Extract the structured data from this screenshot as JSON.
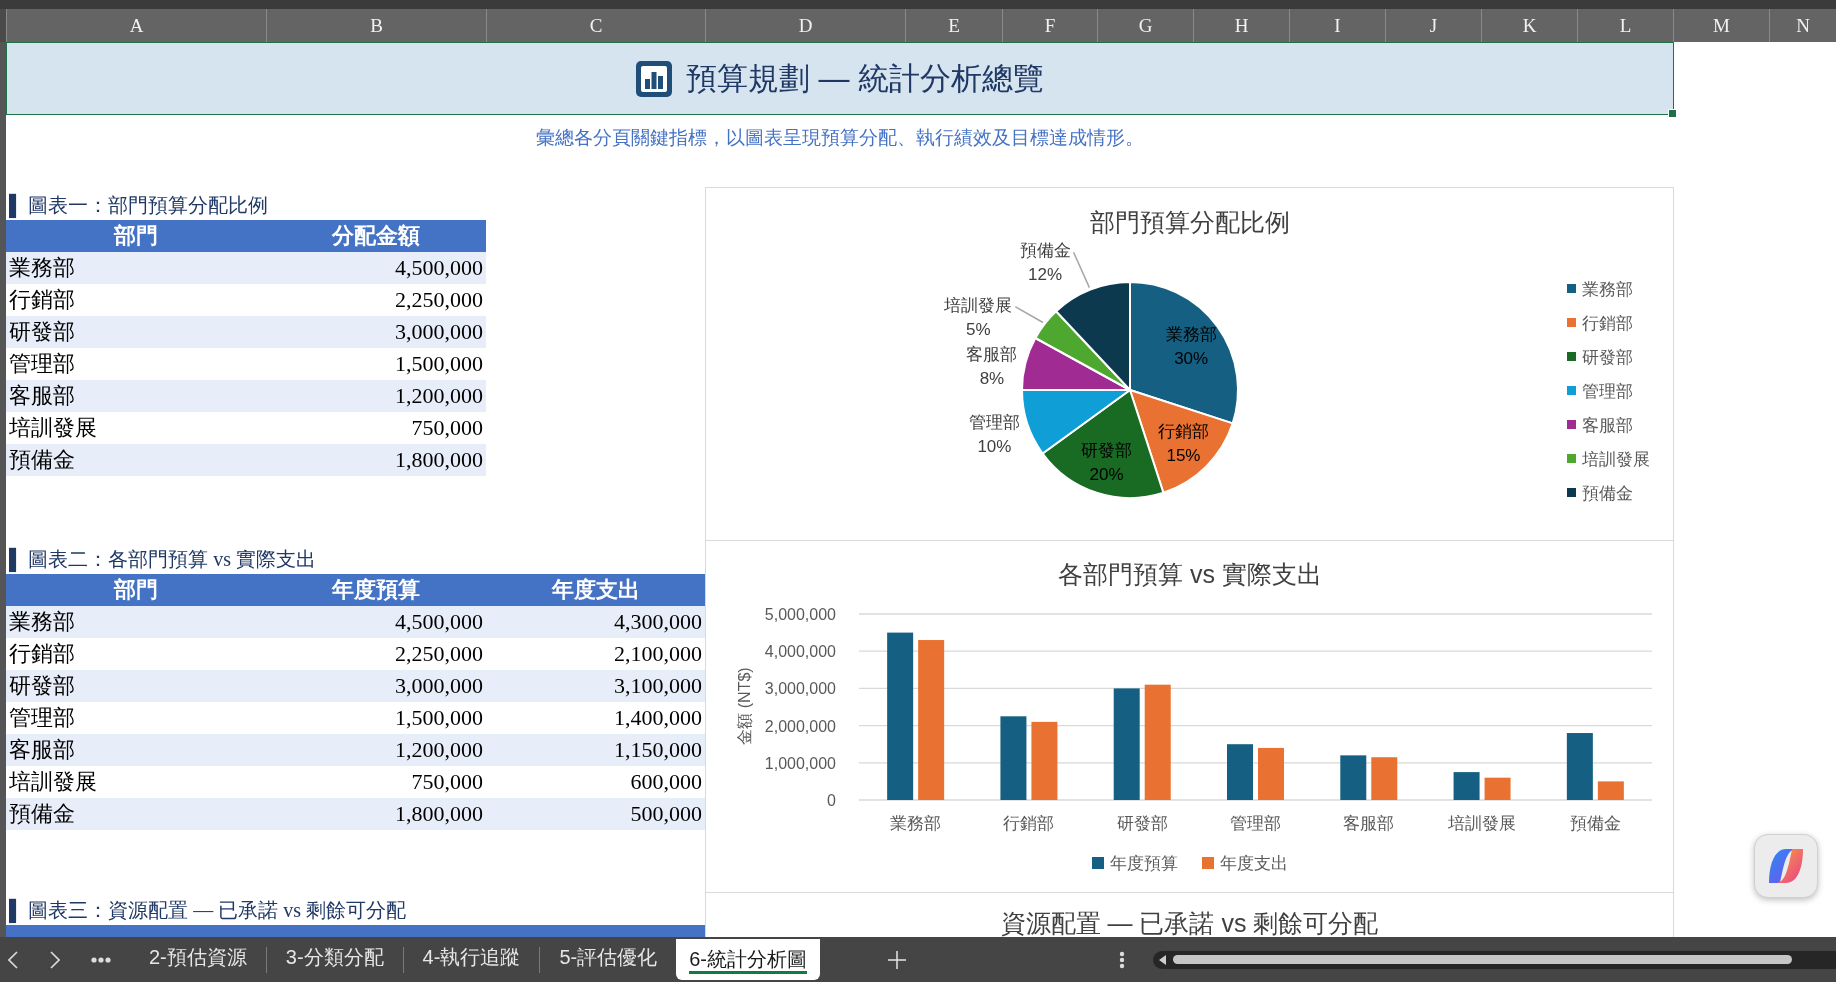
{
  "column_headers": [
    "A",
    "B",
    "C",
    "D",
    "E",
    "F",
    "G",
    "H",
    "I",
    "J",
    "K",
    "L",
    "M",
    "N"
  ],
  "banner": {
    "title": "預算規劃 — 統計分析總覽",
    "selected": true
  },
  "subtitle": "彙總各分頁關鍵指標，以圖表呈現預算分配、執行績效及目標達成情形。",
  "sections": [
    {
      "heading": "▌ 圖表一：部門預算分配比例",
      "table": {
        "columns": [
          "部門",
          "分配金額"
        ],
        "rows": [
          [
            "業務部",
            "4,500,000"
          ],
          [
            "行銷部",
            "2,250,000"
          ],
          [
            "研發部",
            "3,000,000"
          ],
          [
            "管理部",
            "1,500,000"
          ],
          [
            "客服部",
            "1,200,000"
          ],
          [
            "培訓發展",
            "750,000"
          ],
          [
            "預備金",
            "1,800,000"
          ]
        ]
      }
    },
    {
      "heading": "▌ 圖表二：各部門預算 vs 實際支出",
      "table": {
        "columns": [
          "部門",
          "年度預算",
          "年度支出"
        ],
        "rows": [
          [
            "業務部",
            "4,500,000",
            "4,300,000"
          ],
          [
            "行銷部",
            "2,250,000",
            "2,100,000"
          ],
          [
            "研發部",
            "3,000,000",
            "3,100,000"
          ],
          [
            "管理部",
            "1,500,000",
            "1,400,000"
          ],
          [
            "客服部",
            "1,200,000",
            "1,150,000"
          ],
          [
            "培訓發展",
            "750,000",
            "600,000"
          ],
          [
            "預備金",
            "1,800,000",
            "500,000"
          ]
        ]
      }
    },
    {
      "heading": "▌ 圖表三：資源配置 — 已承諾 vs 剩餘可分配"
    }
  ],
  "charts": [
    {
      "chart_data": {
        "type": "pie",
        "title": "部門預算分配比例",
        "categories": [
          "業務部",
          "行銷部",
          "研發部",
          "管理部",
          "客服部",
          "培訓發展",
          "預備金"
        ],
        "values": [
          30,
          15,
          20,
          10,
          8,
          5,
          12
        ],
        "value_labels": [
          "30%",
          "15%",
          "20%",
          "10%",
          "8%",
          "5%",
          "12%"
        ]
      },
      "legend_entries": [
        {
          "label": "業務部",
          "color": "#156082"
        },
        {
          "label": "行銷部",
          "color": "#e97132"
        },
        {
          "label": "研發部",
          "color": "#196b24"
        },
        {
          "label": "管理部",
          "color": "#0f9ed5"
        },
        {
          "label": "客服部",
          "color": "#a02b93"
        },
        {
          "label": "培訓發展",
          "color": "#4ea72e"
        },
        {
          "label": "預備金",
          "color": "#0d394e"
        }
      ]
    },
    {
      "chart_data": {
        "type": "bar",
        "title": "各部門預算 vs 實際支出",
        "ylabel": "金額 (NT$)",
        "categories": [
          "業務部",
          "行銷部",
          "研發部",
          "管理部",
          "客服部",
          "培訓發展",
          "預備金"
        ],
        "series": [
          {
            "name": "年度預算",
            "color": "#156082",
            "values": [
              4500000,
              2250000,
              3000000,
              1500000,
              1200000,
              750000,
              1800000
            ]
          },
          {
            "name": "年度支出",
            "color": "#e97132",
            "values": [
              4300000,
              2100000,
              3100000,
              1400000,
              1150000,
              600000,
              500000
            ]
          }
        ],
        "ylim": [
          0,
          5000000
        ],
        "yticks": [
          0,
          {
            "value": 1000000,
            "label": "1,000,000"
          },
          {
            "value": 2000000,
            "label": "2,000,000"
          },
          {
            "value": 3000000,
            "label": "3,000,000"
          },
          {
            "value": 4000000,
            "label": "4,000,000"
          },
          {
            "value": 5000000,
            "label": "5,000,000"
          }
        ],
        "grid": true,
        "legend": "bottom"
      }
    },
    {
      "title": "資源配置 — 已承諾 vs 剩餘可分配"
    }
  ],
  "sheet_tabs": [
    {
      "label": "2-預估資源",
      "selected": false
    },
    {
      "label": "3-分類分配",
      "selected": false
    },
    {
      "label": "4-執行追蹤",
      "selected": false
    },
    {
      "label": "5-評估優化",
      "selected": false
    },
    {
      "label": "6-統計分析圖",
      "selected": true
    }
  ]
}
